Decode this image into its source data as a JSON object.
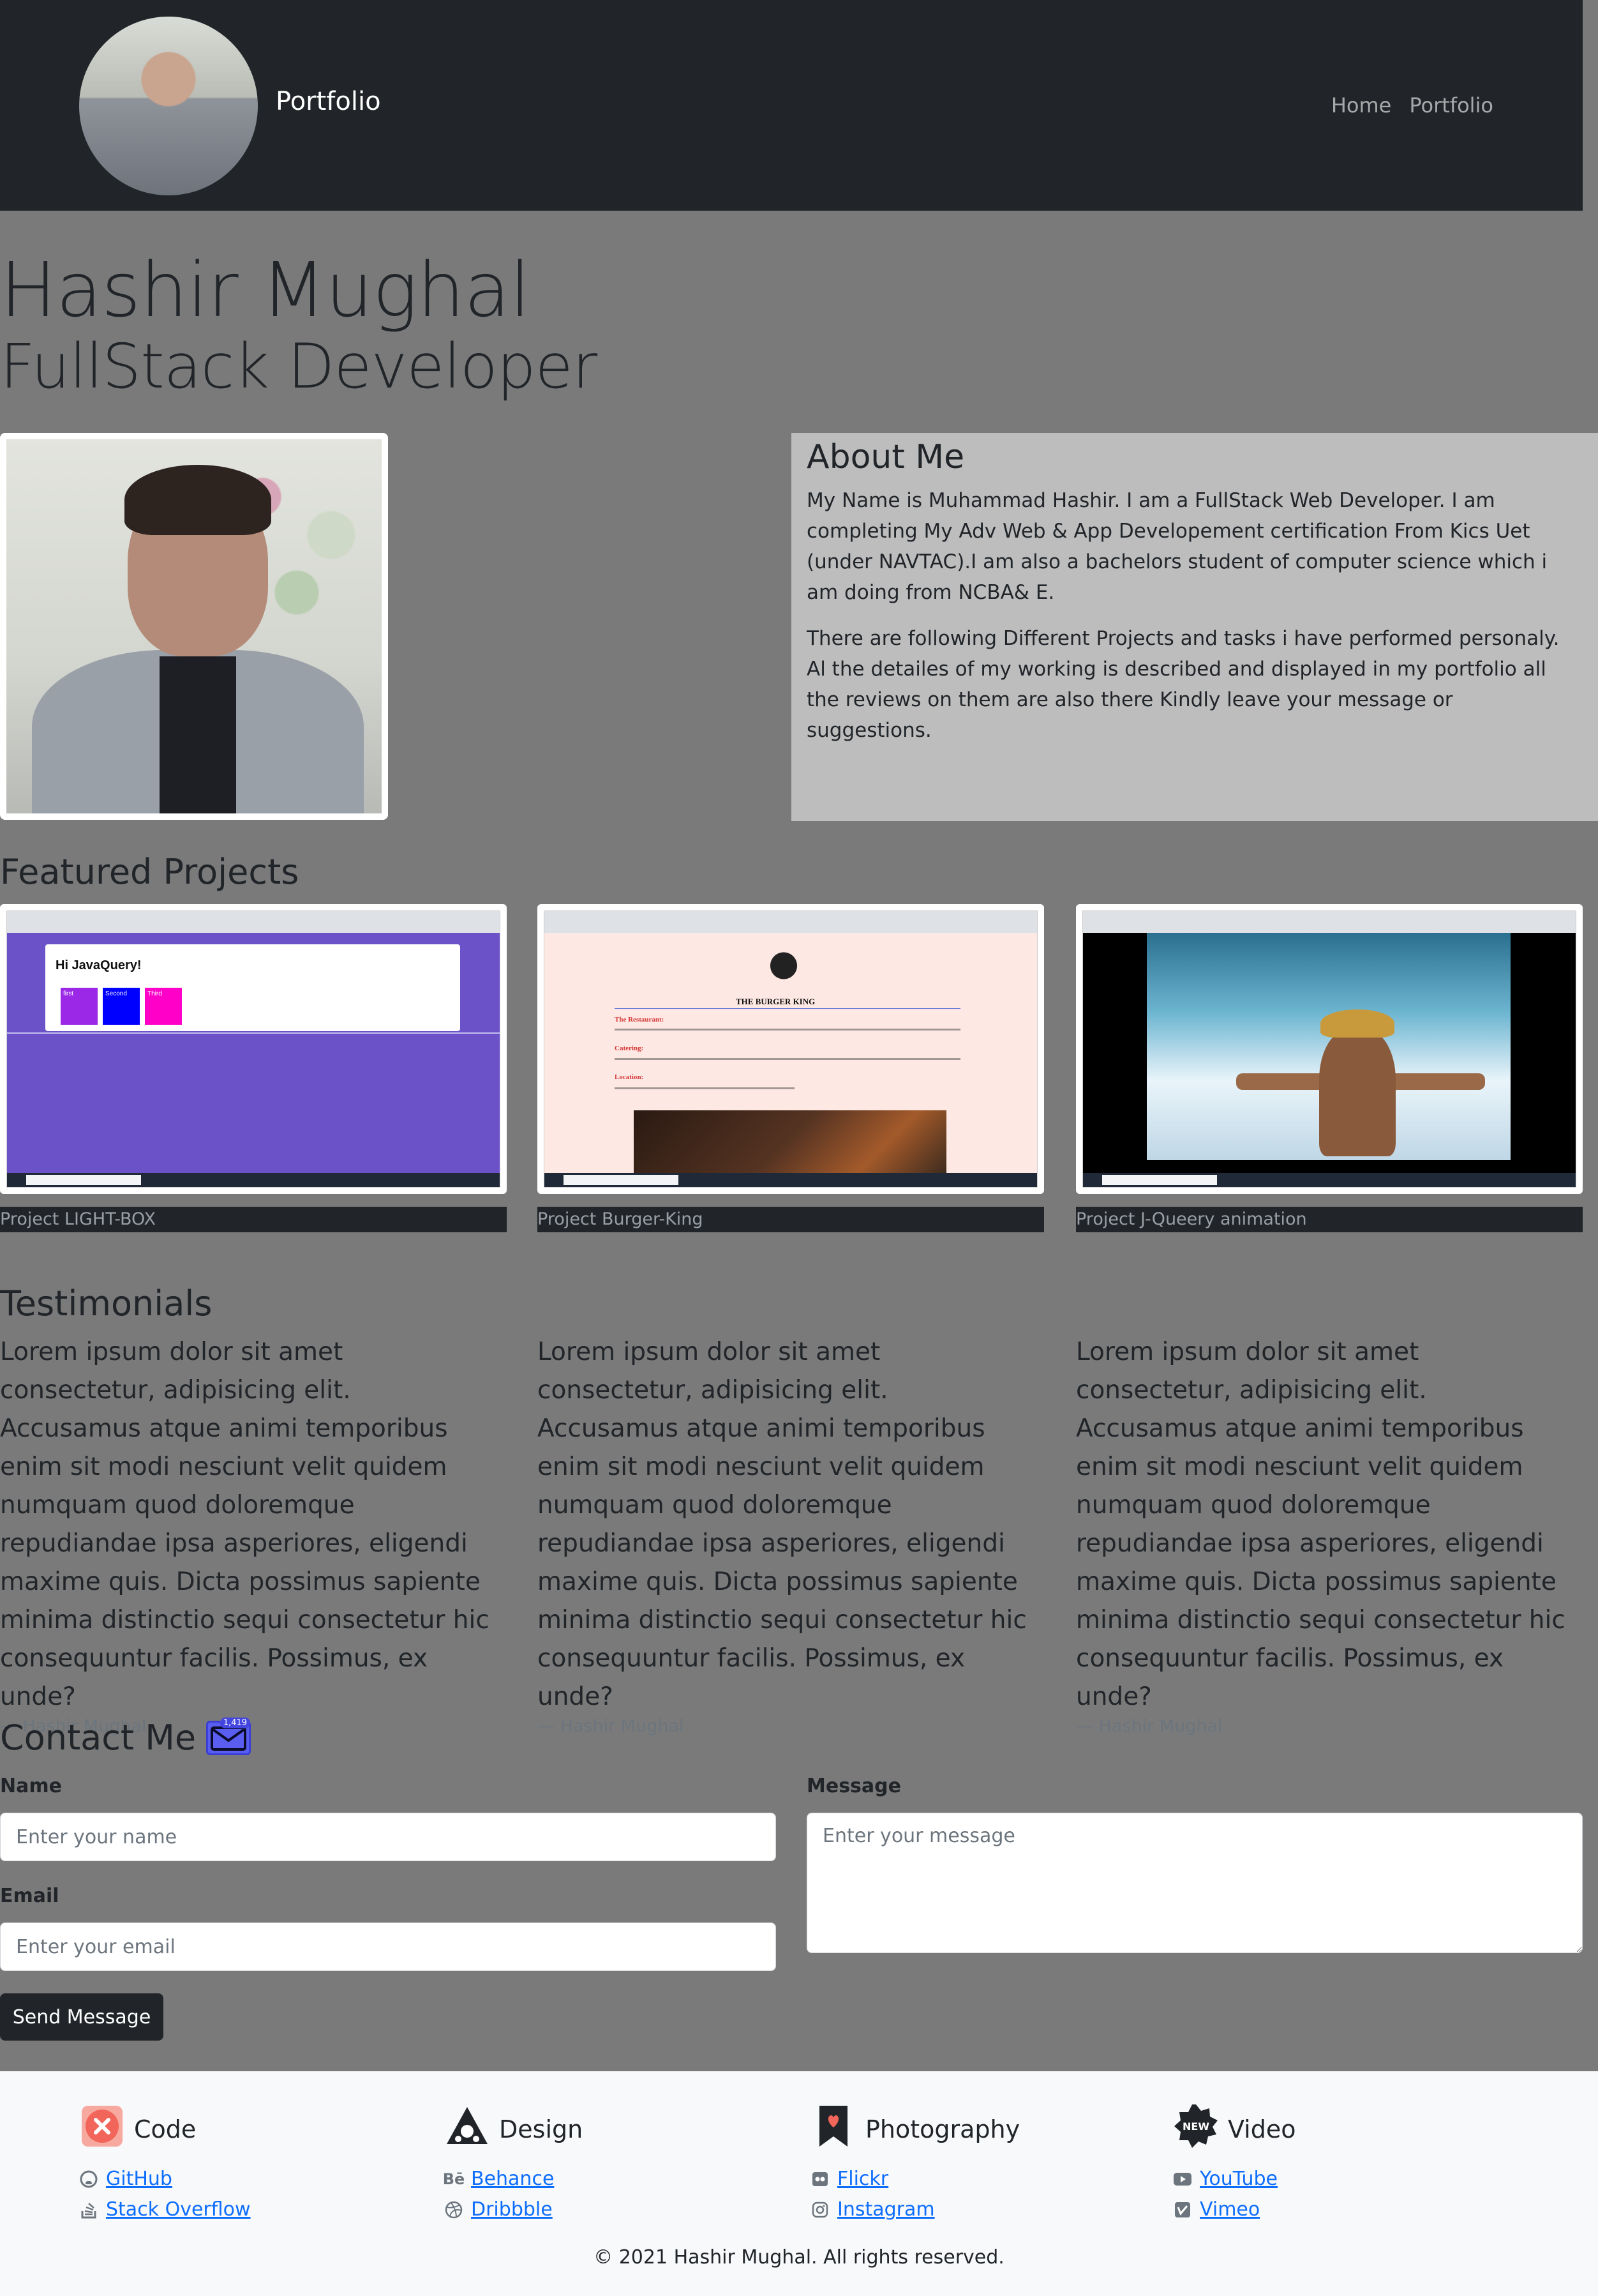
{
  "navbar": {
    "brand": "Portfolio",
    "links": [
      "Home",
      "Portfolio"
    ]
  },
  "hero": {
    "name": "Hashir Mughal",
    "role": "FullStack Developer"
  },
  "about": {
    "title": "About Me",
    "paragraphs": [
      "My Name is Muhammad Hashir. I am a FullStack Web Developer. I am completing My Adv Web & App Developement certification From Kics Uet (under NAVTAC).I am also a bachelors student of computer science which i am doing from NCBA& E.",
      "There are following Different Projects and tasks i have performed personaly. Al the detailes of my working is described and displayed in my portfolio all the reviews on them are also there Kindly leave your message or suggestions."
    ]
  },
  "projects": {
    "title": "Featured Projects",
    "items": [
      {
        "caption": "Project LIGHT-BOX",
        "screen": {
          "heading": "Hi JavaQuery!",
          "boxes": [
            "first",
            "Second",
            "Third"
          ]
        }
      },
      {
        "caption": "Project Burger-King",
        "screen": {
          "heading": "THE BURGER KING",
          "labels": [
            "The Restaurant:",
            "Catering:",
            "Location:"
          ]
        }
      },
      {
        "caption": "Project J-Queery animation",
        "screen": {}
      }
    ]
  },
  "testimonials": {
    "title": "Testimonials",
    "items": [
      {
        "text": "Lorem ipsum dolor sit amet consectetur, adipisicing elit. Accusamus atque animi temporibus enim sit modi nesciunt velit quidem numquam quod doloremque repudiandae ipsa asperiores, eligendi maxime quis. Dicta possimus sapiente minima distinctio sequi consectetur hic consequuntur facilis. Possimus, ex unde?",
        "author": "— Hashir Mughal"
      },
      {
        "text": "Lorem ipsum dolor sit amet consectetur, adipisicing elit. Accusamus atque animi temporibus enim sit modi nesciunt velit quidem numquam quod doloremque repudiandae ipsa asperiores, eligendi maxime quis. Dicta possimus sapiente minima distinctio sequi consectetur hic consequuntur facilis. Possimus, ex unde?",
        "author": "— Hashir Mughal"
      },
      {
        "text": "Lorem ipsum dolor sit amet consectetur, adipisicing elit. Accusamus atque animi temporibus enim sit modi nesciunt velit quidem numquam quod doloremque repudiandae ipsa asperiores, eligendi maxime quis. Dicta possimus sapiente minima distinctio sequi consectetur hic consequuntur facilis. Possimus, ex unde?",
        "author": "— Hashir Mughal"
      }
    ]
  },
  "contact": {
    "title": "Contact Me",
    "badge": "1,419",
    "name_label": "Name",
    "name_placeholder": "Enter your name",
    "email_label": "Email",
    "email_placeholder": "Enter your email",
    "message_label": "Message",
    "message_placeholder": "Enter your message",
    "send_label": "Send Message"
  },
  "footer": {
    "columns": [
      {
        "title": "Code",
        "icon": "code-x-icon",
        "accent": "#f2655a",
        "links": [
          {
            "label": "GitHub",
            "icon": "github-icon"
          },
          {
            "label": "Stack Overflow",
            "icon": "stackoverflow-icon"
          }
        ]
      },
      {
        "title": "Design",
        "icon": "design-triangle-icon",
        "accent": "#212529",
        "links": [
          {
            "label": "Behance",
            "icon": "behance-icon"
          },
          {
            "label": "Dribbble",
            "icon": "dribbble-icon"
          }
        ]
      },
      {
        "title": "Photography",
        "icon": "bookmark-heart-icon",
        "accent": "#212529",
        "links": [
          {
            "label": "Flickr",
            "icon": "flickr-icon"
          },
          {
            "label": "Instagram",
            "icon": "instagram-icon"
          }
        ]
      },
      {
        "title": "Video",
        "icon": "new-badge-icon",
        "accent": "#212529",
        "links": [
          {
            "label": "YouTube",
            "icon": "youtube-icon"
          },
          {
            "label": "Vimeo",
            "icon": "vimeo-icon"
          }
        ]
      }
    ],
    "copyright": "© 2021 Hashir Mughal. All rights reserved."
  },
  "colors": {
    "navbar_bg": "#212529",
    "page_bg": "#7a7a7a",
    "about_bg": "#bdbdbd",
    "link": "#0d6efd",
    "footer_bg": "#f8f9fa"
  }
}
